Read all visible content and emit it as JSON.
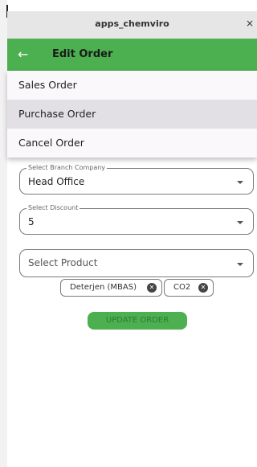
{
  "window": {
    "title": "apps_chemviro",
    "close_glyph": "×"
  },
  "appbar": {
    "back_glyph": "←",
    "title": "Edit Order"
  },
  "menu": {
    "items": [
      "Sales Order",
      "Purchase Order",
      "Cancel Order"
    ],
    "selected": "Purchase Order"
  },
  "form": {
    "branch": {
      "label": "Select Branch Company",
      "value": "Head Office"
    },
    "discount": {
      "label": "Select Discount",
      "value": "5"
    },
    "product": {
      "placeholder": "Select Product"
    },
    "chips": [
      {
        "label": "Deterjen (MBAS)"
      },
      {
        "label": "CO2"
      }
    ],
    "update_button": "UPDATE ORDER"
  },
  "icons": {
    "back": "arrow-left-icon",
    "close": "close-icon",
    "dropdown": "chevron-down-icon",
    "remove": "remove-chip-icon"
  },
  "colors": {
    "primary": "#4caf50",
    "button_text": "#2e7d32",
    "menu_bg": "#fbf8fb",
    "menu_selected": "#e2e0e4",
    "titlebar": "#e6e6e6"
  }
}
